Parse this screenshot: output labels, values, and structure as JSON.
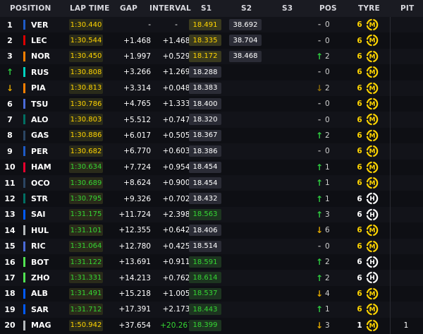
{
  "headers": {
    "position": "POSITION",
    "lap_time": "LAP TIME",
    "gap": "GAP",
    "interval": "INTERVAL",
    "s1": "S1",
    "s2": "S2",
    "s3": "S3",
    "pos": "POS",
    "tyre": "TYRE",
    "pit": "PIT"
  },
  "colors": {
    "header_bg": "#1a1b22",
    "yellow": "#ffd400",
    "green": "#35d633",
    "up_arrow": "#2ecc40",
    "down_arrow": "#e0a800"
  },
  "rows": [
    {
      "position": "1",
      "position_icon": "none",
      "team_color": "#1e5bc6",
      "driver": "VER",
      "lap_time": "1:30.440",
      "lap_color": "yellow",
      "gap": "-",
      "interval": "-",
      "interval_color": "white",
      "s1": "18.491",
      "s1_color": "yellow",
      "s2": "38.692",
      "pos_change_icon": "dash",
      "pos_change": "0",
      "tyre_laps": "6",
      "tyre_laps_color": "yellow",
      "tyre_compound": "M",
      "pit": ""
    },
    {
      "position": "2",
      "position_icon": "none",
      "team_color": "#dc0000",
      "driver": "LEC",
      "lap_time": "1:30.544",
      "lap_color": "yellow",
      "gap": "+1.468",
      "interval": "+1.468",
      "interval_color": "white",
      "s1": "18.335",
      "s1_color": "yellow",
      "s2": "38.704",
      "pos_change_icon": "dash",
      "pos_change": "0",
      "tyre_laps": "6",
      "tyre_laps_color": "yellow",
      "tyre_compound": "M",
      "pit": ""
    },
    {
      "position": "3",
      "position_icon": "none",
      "team_color": "#ff8000",
      "driver": "NOR",
      "lap_time": "1:30.450",
      "lap_color": "yellow",
      "gap": "+1.997",
      "interval": "+0.529",
      "interval_color": "white",
      "s1": "18.172",
      "s1_color": "yellow",
      "s2": "38.468",
      "pos_change_icon": "up",
      "pos_change": "2",
      "tyre_laps": "6",
      "tyre_laps_color": "yellow",
      "tyre_compound": "M",
      "pit": ""
    },
    {
      "position": "",
      "position_icon": "up",
      "team_color": "#00d2be",
      "driver": "RUS",
      "lap_time": "1:30.808",
      "lap_color": "yellow",
      "gap": "+3.266",
      "interval": "+1.269",
      "interval_color": "white",
      "s1": "18.288",
      "s1_color": "white",
      "s2": "",
      "pos_change_icon": "dash",
      "pos_change": "0",
      "tyre_laps": "6",
      "tyre_laps_color": "yellow",
      "tyre_compound": "M",
      "pit": ""
    },
    {
      "position": "",
      "position_icon": "down",
      "team_color": "#ff8000",
      "driver": "PIA",
      "lap_time": "1:30.813",
      "lap_color": "yellow",
      "gap": "+3.314",
      "interval": "+0.048",
      "interval_color": "white",
      "s1": "18.383",
      "s1_color": "white",
      "s2": "",
      "pos_change_icon": "down-dim",
      "pos_change": "2",
      "tyre_laps": "6",
      "tyre_laps_color": "yellow",
      "tyre_compound": "M",
      "pit": ""
    },
    {
      "position": "6",
      "position_icon": "none",
      "team_color": "#4a6bd8",
      "driver": "TSU",
      "lap_time": "1:30.786",
      "lap_color": "yellow",
      "gap": "+4.765",
      "interval": "+1.333",
      "interval_color": "white",
      "s1": "18.400",
      "s1_color": "white",
      "s2": "",
      "pos_change_icon": "dash",
      "pos_change": "0",
      "tyre_laps": "6",
      "tyre_laps_color": "yellow",
      "tyre_compound": "M",
      "pit": ""
    },
    {
      "position": "7",
      "position_icon": "none",
      "team_color": "#006f62",
      "driver": "ALO",
      "lap_time": "1:30.803",
      "lap_color": "yellow",
      "gap": "+5.512",
      "interval": "+0.747",
      "interval_color": "white",
      "s1": "18.320",
      "s1_color": "white",
      "s2": "",
      "pos_change_icon": "dash",
      "pos_change": "0",
      "tyre_laps": "6",
      "tyre_laps_color": "yellow",
      "tyre_compound": "M",
      "pit": ""
    },
    {
      "position": "8",
      "position_icon": "none",
      "team_color": "#2b4562",
      "driver": "GAS",
      "lap_time": "1:30.886",
      "lap_color": "yellow",
      "gap": "+6.017",
      "interval": "+0.505",
      "interval_color": "white",
      "s1": "18.367",
      "s1_color": "white",
      "s2": "",
      "pos_change_icon": "up",
      "pos_change": "2",
      "tyre_laps": "6",
      "tyre_laps_color": "yellow",
      "tyre_compound": "M",
      "pit": ""
    },
    {
      "position": "9",
      "position_icon": "none",
      "team_color": "#1e5bc6",
      "driver": "PER",
      "lap_time": "1:30.682",
      "lap_color": "yellow",
      "gap": "+6.770",
      "interval": "+0.603",
      "interval_color": "white",
      "s1": "18.386",
      "s1_color": "white",
      "s2": "",
      "pos_change_icon": "dash",
      "pos_change": "0",
      "tyre_laps": "6",
      "tyre_laps_color": "yellow",
      "tyre_compound": "M",
      "pit": ""
    },
    {
      "position": "10",
      "position_icon": "none",
      "team_color": "#e8002d",
      "driver": "HAM",
      "lap_time": "1:30.634",
      "lap_color": "green",
      "gap": "+7.724",
      "interval": "+0.954",
      "interval_color": "white",
      "s1": "18.454",
      "s1_color": "white",
      "s2": "",
      "pos_change_icon": "up",
      "pos_change": "1",
      "tyre_laps": "6",
      "tyre_laps_color": "yellow",
      "tyre_compound": "M",
      "pit": ""
    },
    {
      "position": "11",
      "position_icon": "none",
      "team_color": "#2b4562",
      "driver": "OCO",
      "lap_time": "1:30.689",
      "lap_color": "green",
      "gap": "+8.624",
      "interval": "+0.900",
      "interval_color": "white",
      "s1": "18.454",
      "s1_color": "white",
      "s2": "",
      "pos_change_icon": "up",
      "pos_change": "1",
      "tyre_laps": "6",
      "tyre_laps_color": "yellow",
      "tyre_compound": "M",
      "pit": ""
    },
    {
      "position": "12",
      "position_icon": "none",
      "team_color": "#006f62",
      "driver": "STR",
      "lap_time": "1:30.795",
      "lap_color": "green",
      "gap": "+9.326",
      "interval": "+0.702",
      "interval_color": "white",
      "s1": "18.432",
      "s1_color": "white",
      "s2": "",
      "pos_change_icon": "up",
      "pos_change": "1",
      "tyre_laps": "6",
      "tyre_laps_color": "white",
      "tyre_compound": "H",
      "pit": ""
    },
    {
      "position": "13",
      "position_icon": "none",
      "team_color": "#005aff",
      "driver": "SAI",
      "lap_time": "1:31.175",
      "lap_color": "green",
      "gap": "+11.724",
      "interval": "+2.398",
      "interval_color": "white",
      "s1": "18.563",
      "s1_color": "green",
      "s2": "",
      "pos_change_icon": "up",
      "pos_change": "3",
      "tyre_laps": "6",
      "tyre_laps_color": "white",
      "tyre_compound": "H",
      "pit": ""
    },
    {
      "position": "14",
      "position_icon": "none",
      "team_color": "#b6babd",
      "driver": "HUL",
      "lap_time": "1:31.101",
      "lap_color": "green",
      "gap": "+12.355",
      "interval": "+0.642",
      "interval_color": "white",
      "s1": "18.406",
      "s1_color": "white",
      "s2": "",
      "pos_change_icon": "down",
      "pos_change": "6",
      "tyre_laps": "6",
      "tyre_laps_color": "yellow",
      "tyre_compound": "M",
      "pit": ""
    },
    {
      "position": "15",
      "position_icon": "none",
      "team_color": "#4a6bd8",
      "driver": "RIC",
      "lap_time": "1:31.064",
      "lap_color": "green",
      "gap": "+12.780",
      "interval": "+0.425",
      "interval_color": "white",
      "s1": "18.514",
      "s1_color": "white",
      "s2": "",
      "pos_change_icon": "dash",
      "pos_change": "0",
      "tyre_laps": "6",
      "tyre_laps_color": "yellow",
      "tyre_compound": "M",
      "pit": ""
    },
    {
      "position": "16",
      "position_icon": "none",
      "team_color": "#52e252",
      "driver": "BOT",
      "lap_time": "1:31.122",
      "lap_color": "green",
      "gap": "+13.691",
      "interval": "+0.911",
      "interval_color": "white",
      "s1": "18.591",
      "s1_color": "green",
      "s2": "",
      "pos_change_icon": "up",
      "pos_change": "2",
      "tyre_laps": "6",
      "tyre_laps_color": "white",
      "tyre_compound": "H",
      "pit": ""
    },
    {
      "position": "17",
      "position_icon": "none",
      "team_color": "#52e252",
      "driver": "ZHO",
      "lap_time": "1:31.331",
      "lap_color": "green",
      "gap": "+14.213",
      "interval": "+0.762",
      "interval_color": "white",
      "s1": "18.614",
      "s1_color": "green",
      "s2": "",
      "pos_change_icon": "up",
      "pos_change": "2",
      "tyre_laps": "6",
      "tyre_laps_color": "white",
      "tyre_compound": "H",
      "pit": ""
    },
    {
      "position": "18",
      "position_icon": "none",
      "team_color": "#005aff",
      "driver": "ALB",
      "lap_time": "1:31.491",
      "lap_color": "green",
      "gap": "+15.218",
      "interval": "+1.005",
      "interval_color": "white",
      "s1": "18.537",
      "s1_color": "green",
      "s2": "",
      "pos_change_icon": "down",
      "pos_change": "4",
      "tyre_laps": "6",
      "tyre_laps_color": "yellow",
      "tyre_compound": "M",
      "pit": ""
    },
    {
      "position": "19",
      "position_icon": "none",
      "team_color": "#005aff",
      "driver": "SAR",
      "lap_time": "1:31.712",
      "lap_color": "green",
      "gap": "+17.391",
      "interval": "+2.173",
      "interval_color": "white",
      "s1": "18.443",
      "s1_color": "green",
      "s2": "",
      "pos_change_icon": "up",
      "pos_change": "1",
      "tyre_laps": "6",
      "tyre_laps_color": "yellow",
      "tyre_compound": "M",
      "pit": ""
    },
    {
      "position": "20",
      "position_icon": "none",
      "team_color": "#b6babd",
      "driver": "MAG",
      "lap_time": "1:50.942",
      "lap_color": "yellow",
      "gap": "+37.654",
      "interval": "+20.267",
      "interval_color": "green",
      "s1": "18.399",
      "s1_color": "green",
      "s2": "",
      "pos_change_icon": "down",
      "pos_change": "3",
      "tyre_laps": "1",
      "tyre_laps_color": "white",
      "tyre_compound": "M",
      "pit": "1"
    }
  ]
}
